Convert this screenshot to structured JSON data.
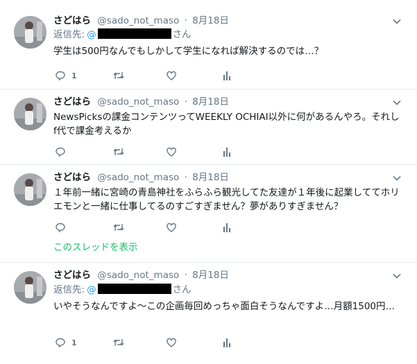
{
  "tweets": [
    {
      "name": "さどはら",
      "handle": "@sado_not_maso",
      "dot": "·",
      "date": "8月18日",
      "reply_label": "返信先:",
      "reply_at": "@",
      "reply_suffix": "さん",
      "text": "学生は500円なんでもしかして学生になれば解決するのでは…？",
      "reply_count": "1"
    },
    {
      "name": "さどはら",
      "handle": "@sado_not_maso",
      "dot": "·",
      "date": "8月18日",
      "text": "NewsPicksの課金コンテンツってWEEKLY OCHIAI以外に何があるんやろ。それし f代で課金考えるか",
      "reply_count": ""
    },
    {
      "name": "さどはら",
      "handle": "@sado_not_maso",
      "dot": "·",
      "date": "8月18日",
      "text": "１年前一緒に宮崎の青島神社をふらふら観光してた友達が１年後に起業しててホリエモンと一緒に仕事してるのすごすぎません？夢がありすぎません？",
      "reply_count": "",
      "thread_link": "このスレッドを表示"
    },
    {
      "name": "さどはら",
      "handle": "@sado_not_maso",
      "dot": "·",
      "date": "8月18日",
      "reply_label": "返信先:",
      "reply_at": "@",
      "reply_suffix": "さん",
      "text": "いやそうなんですよ〜この企画毎回めっちゃ面白そうなんですよ…月額1500円…",
      "reply_count": "1"
    }
  ],
  "colors": {
    "text": "#14171a",
    "muted": "#657786",
    "link": "#1da1f2",
    "thread": "#17bf63",
    "divider": "#e6ecf0"
  },
  "icons": [
    "avatar",
    "chevron-down-icon",
    "reply-icon",
    "retweet-icon",
    "like-icon",
    "analytics-icon"
  ]
}
